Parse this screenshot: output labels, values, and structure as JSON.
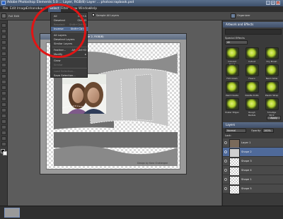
{
  "title_bar": {
    "app_title": "Adobe Photoshop Elements 5.0 ... Layer, RGB/8) Layer ... photoscrapbook.psd"
  },
  "menu_bar": {
    "items": [
      "File",
      "Edit",
      "Image",
      "Enhance",
      "Layer",
      "Select",
      "Filter",
      "View",
      "Window",
      "Help"
    ],
    "help_search_placeholder": "Type a question for help"
  },
  "options_bar": {
    "create_label": "Full Edit",
    "sample_all_layers": "Sample All Layers",
    "organizer": "Organizer"
  },
  "document": {
    "title": "...8.75% (Shape 2, RGB/8)",
    "footer": "Design by Kara Chattergee"
  },
  "select_menu": {
    "items": [
      {
        "label": "All",
        "shortcut": "Ctrl+A",
        "state": "normal"
      },
      {
        "label": "Deselect",
        "shortcut": "Ctrl+D",
        "state": "normal"
      },
      {
        "label": "Reselect",
        "shortcut": "Shift+Ctrl+D",
        "state": "dim"
      },
      {
        "label": "Inverse",
        "shortcut": "Shift+Ctrl+I",
        "state": "highlight"
      },
      {
        "label": "All Layers",
        "shortcut": "",
        "state": "normal"
      },
      {
        "label": "Deselect Layers",
        "shortcut": "",
        "state": "normal"
      },
      {
        "label": "Similar Layers",
        "shortcut": "",
        "state": "normal"
      },
      {
        "label": "Feather...",
        "shortcut": "Alt+Ctrl+D",
        "state": "normal"
      },
      {
        "label": "Modify",
        "shortcut": "▸",
        "state": "normal"
      },
      {
        "label": "Grow",
        "shortcut": "",
        "state": "normal"
      },
      {
        "label": "Similar",
        "shortcut": "",
        "state": "dim"
      },
      {
        "label": "Load Selection...",
        "shortcut": "",
        "state": "dim"
      },
      {
        "label": "Save Selection...",
        "shortcut": "",
        "state": "normal"
      },
      {
        "label": "Delete Selection...",
        "shortcut": "",
        "state": "dim"
      }
    ]
  },
  "artwork_panel": {
    "title": "Artwork and Effects",
    "section": "Special Effects",
    "dropdown": "All",
    "thumbs": [
      "Colored Pencil",
      "Cutout",
      "Dry Brush",
      "Film Grain",
      "Fresco",
      "Neon Glow",
      "Paint Daubs",
      "Palette Knife",
      "Plastic Wrap",
      "Poster Edges",
      "Rough Pastels",
      "Smudge Stick"
    ],
    "apply_button": "Apply"
  },
  "layers_panel": {
    "title": "Layers",
    "blend_mode": "Normal",
    "opacity_label": "Opacity:",
    "opacity_value": "100%",
    "lock_label": "Lock:",
    "layers": [
      {
        "name": "Layer 1",
        "selected": false
      },
      {
        "name": "Shape 2",
        "selected": true
      },
      {
        "name": "Shape 3",
        "selected": false
      },
      {
        "name": "Shape 4",
        "selected": false
      },
      {
        "name": "Shape 1",
        "selected": false
      },
      {
        "name": "Shape 5",
        "selected": false
      }
    ]
  },
  "colors": {
    "highlight": "#50688e",
    "circle": "#e21414"
  }
}
